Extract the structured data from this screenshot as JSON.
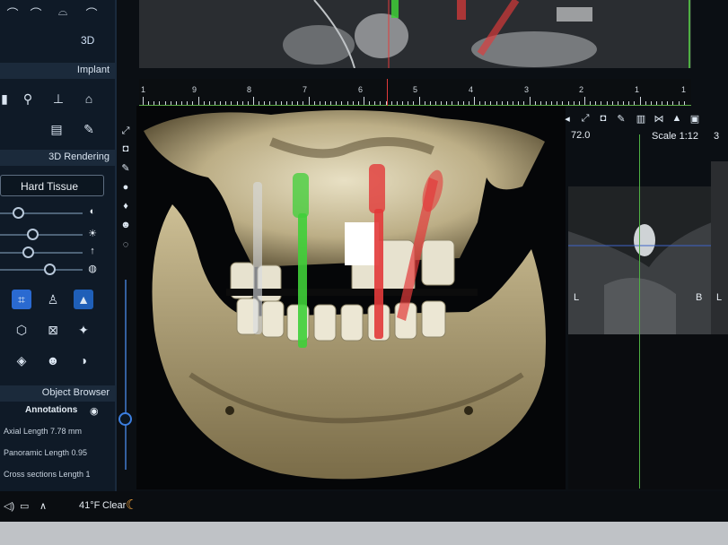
{
  "sidebar": {
    "mode_label": "3D",
    "implant_header": "Implant",
    "rendering_header": "3D Rendering",
    "rendering_preset": "Hard Tissue",
    "object_browser_header": "Object Browser",
    "annotations_label": "Annotations",
    "annotations": [
      "Axial   Length 7.78 mm",
      "Panoramic   Length 0.95",
      "Cross sections   Length 1"
    ],
    "sliders": [
      {
        "icon": "contrast-icon",
        "level": 0.18
      },
      {
        "icon": "brightness-icon",
        "level": 0.38
      },
      {
        "icon": "arrow-up-icon",
        "level": 0.32
      },
      {
        "icon": "opacity-icon",
        "level": 0.62
      }
    ]
  },
  "top_ruler": {
    "ticks": [
      "1",
      "9",
      "8",
      "7",
      "6",
      "5",
      "4",
      "3",
      "2",
      "1",
      "1"
    ]
  },
  "right_panel": {
    "angle": "72.0",
    "scale": "Scale 1:12",
    "partial_label": "3",
    "left_marker": "L",
    "right_marker": "B",
    "far_marker": "L"
  },
  "taskbar": {
    "temperature": "41°F",
    "weather": "Clear"
  },
  "colors": {
    "panel_bg": "#0f1a27",
    "selected_blue": "#2a6ad1",
    "implant_green": "#3fcf38",
    "implant_red": "#e23a3a",
    "bone": "#d6cfb4",
    "guide_green": "#4fb043"
  }
}
